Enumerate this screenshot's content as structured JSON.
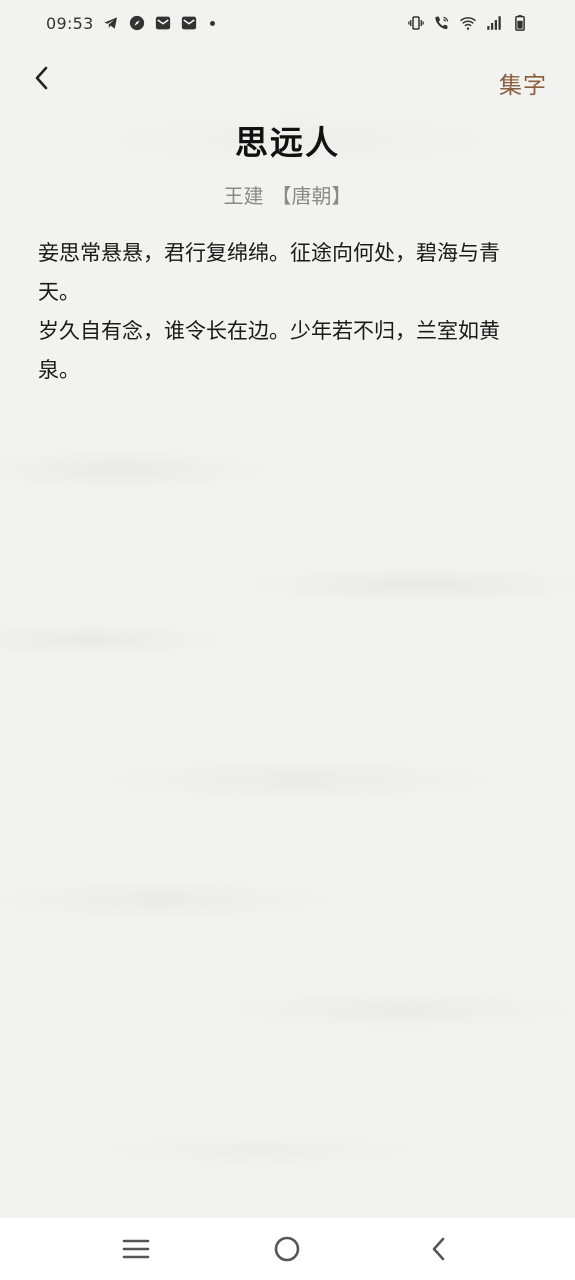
{
  "status_bar": {
    "time": "09:53",
    "left_icons": [
      "telegram-icon",
      "compass-icon",
      "mail-icon",
      "mail-icon",
      "dot-icon"
    ],
    "right_icons": [
      "vibrate-icon",
      "wifi-call-icon",
      "wifi-icon",
      "signal-icon",
      "battery-icon"
    ]
  },
  "header": {
    "back_icon": "chevron-left-icon",
    "collect_label": "集字"
  },
  "poem": {
    "title": "思远人",
    "author": "王建",
    "dynasty": "【唐朝】",
    "lines": [
      "妾思常悬悬，君行复绵绵。征途向何处，碧海与青天。",
      "岁久自有念，谁令长在边。少年若不归，兰室如黄泉。"
    ]
  },
  "nav_bar": {
    "icons": [
      "menu-icon",
      "home-icon",
      "back-icon"
    ]
  },
  "colors": {
    "accent": "#8b5e3c",
    "meta_text": "#8a8a8a",
    "background": "#f2f2f1"
  }
}
